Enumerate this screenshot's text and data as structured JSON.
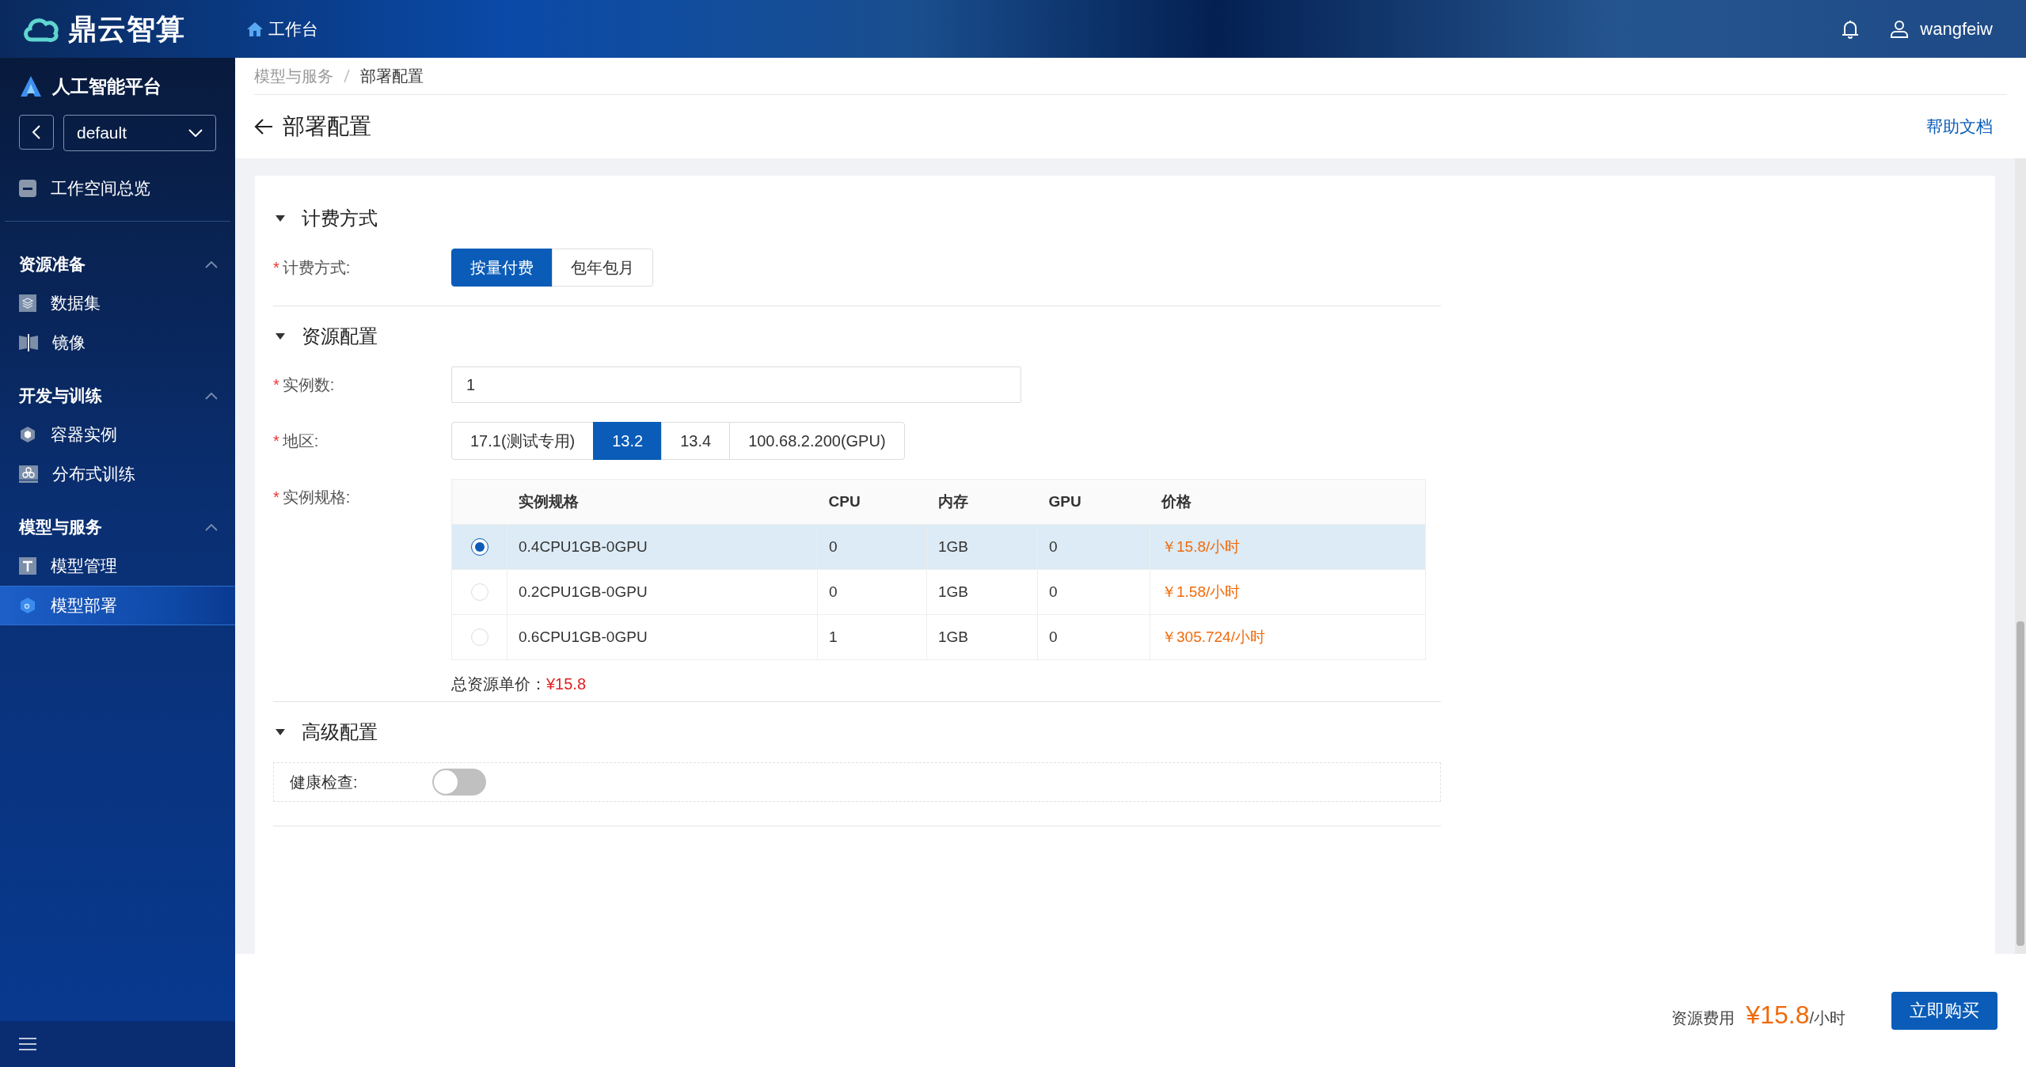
{
  "header": {
    "brand": "鼎云智算",
    "nav": "工作台",
    "user": "wangfeiw"
  },
  "sidebar": {
    "platform": "人工智能平台",
    "workspace": "default",
    "overview": "工作空间总览",
    "groups": [
      {
        "title": "资源准备",
        "expanded": true,
        "items": [
          {
            "label": "数据集",
            "selected": false
          },
          {
            "label": "镜像",
            "selected": false
          }
        ]
      },
      {
        "title": "开发与训练",
        "expanded": true,
        "items": [
          {
            "label": "容器实例",
            "selected": false
          },
          {
            "label": "分布式训练",
            "selected": false
          }
        ]
      },
      {
        "title": "模型与服务",
        "expanded": true,
        "items": [
          {
            "label": "模型管理",
            "selected": false
          },
          {
            "label": "模型部署",
            "selected": true
          }
        ]
      }
    ]
  },
  "breadcrumb": [
    "模型与服务",
    "部署配置"
  ],
  "page_title": "部署配置",
  "help_link": "帮助文档",
  "sections": [
    {
      "title": "计费方式",
      "expanded": true,
      "fields": [
        {
          "kind": "segmented",
          "required_mark": "*",
          "label": "计费方式:",
          "options": [
            {
              "label": "按量付费",
              "selected": true
            },
            {
              "label": "包年包月",
              "selected": false
            }
          ]
        }
      ]
    },
    {
      "title": "资源配置",
      "expanded": true,
      "fields": [
        {
          "kind": "input",
          "required_mark": "*",
          "label": "实例数:",
          "value": "1"
        },
        {
          "kind": "segmented",
          "required_mark": "*",
          "label": "地区:",
          "options": [
            {
              "label": "17.1(测试专用)",
              "selected": false
            },
            {
              "label": "13.2",
              "selected": true
            },
            {
              "label": "13.4",
              "selected": false
            },
            {
              "label": "100.68.2.200(GPU)",
              "selected": false
            }
          ]
        },
        {
          "kind": "table",
          "required_mark": "*",
          "label": "实例规格:",
          "columns": [
            {
              "label": "实例规格",
              "kind": "text"
            },
            {
              "label": "CPU",
              "kind": "text"
            },
            {
              "label": "内存",
              "kind": "text"
            },
            {
              "label": "GPU",
              "kind": "text"
            },
            {
              "label": "价格",
              "kind": "price"
            }
          ],
          "rows": [
            {
              "selected": true,
              "cells": [
                "0.4CPU1GB-0GPU",
                "0",
                "1GB",
                "0",
                "￥15.8/小时"
              ]
            },
            {
              "selected": false,
              "cells": [
                "0.2CPU1GB-0GPU",
                "0",
                "1GB",
                "0",
                "￥1.58/小时"
              ]
            },
            {
              "selected": false,
              "cells": [
                "0.6CPU1GB-0GPU",
                "1",
                "1GB",
                "0",
                "￥305.724/小时"
              ]
            }
          ],
          "total_label": "总资源单价：",
          "total_value": "¥15.8"
        }
      ]
    },
    {
      "title": "高级配置",
      "expanded": true,
      "fields": [
        {
          "kind": "switch",
          "label": "健康检查:",
          "on": false
        }
      ]
    }
  ],
  "footer": {
    "cost_label": "资源费用",
    "cost_value": "¥15.8",
    "cost_unit": "/小时",
    "buy_button": "立即购买"
  }
}
